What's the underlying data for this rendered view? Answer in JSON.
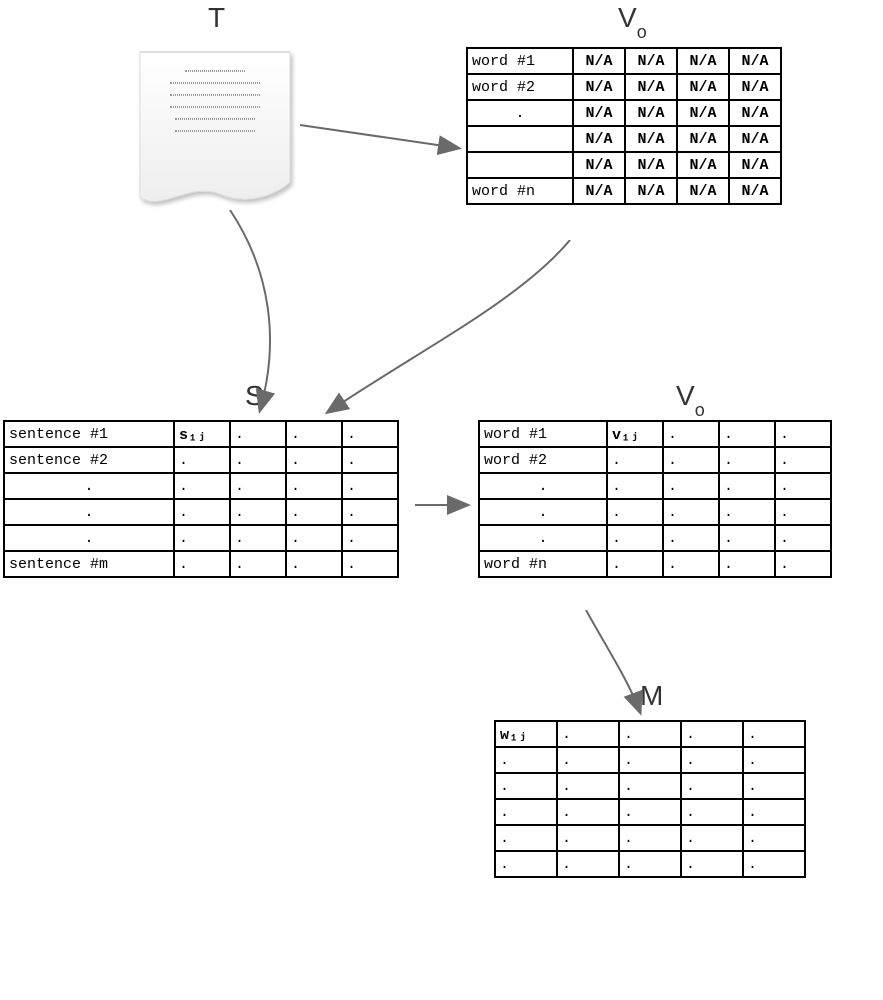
{
  "labels": {
    "T": "T",
    "Vo_top": "V",
    "Vo_top_sub": "o",
    "S": "S",
    "Vo_bot": "V",
    "Vo_bot_sub": "o",
    "M": "M"
  },
  "vo_top": {
    "rows": [
      {
        "label": "word #1",
        "cells": [
          "N/A",
          "N/A",
          "N/A",
          "N/A"
        ]
      },
      {
        "label": "word #2",
        "cells": [
          "N/A",
          "N/A",
          "N/A",
          "N/A"
        ]
      },
      {
        "label": ".",
        "cells": [
          "N/A",
          "N/A",
          "N/A",
          "N/A"
        ]
      },
      {
        "label": "",
        "cells": [
          "N/A",
          "N/A",
          "N/A",
          "N/A"
        ]
      },
      {
        "label": "",
        "cells": [
          "N/A",
          "N/A",
          "N/A",
          "N/A"
        ]
      },
      {
        "label": "word #n",
        "cells": [
          "N/A",
          "N/A",
          "N/A",
          "N/A"
        ]
      }
    ]
  },
  "s_table": {
    "rows": [
      {
        "label": "sentence #1",
        "cells": [
          "s₁ⱼ",
          ".",
          ".",
          "."
        ]
      },
      {
        "label": "sentence #2",
        "cells": [
          ".",
          ".",
          ".",
          "."
        ]
      },
      {
        "label": ".",
        "cells": [
          ".",
          ".",
          ".",
          "."
        ]
      },
      {
        "label": ".",
        "cells": [
          ".",
          ".",
          ".",
          "."
        ]
      },
      {
        "label": ".",
        "cells": [
          ".",
          ".",
          ".",
          "."
        ]
      },
      {
        "label": "sentence #m",
        "cells": [
          ".",
          ".",
          ".",
          "."
        ]
      }
    ]
  },
  "vo_bot": {
    "rows": [
      {
        "label": "word #1",
        "cells": [
          "v₁ⱼ",
          ".",
          ".",
          "."
        ]
      },
      {
        "label": "word #2",
        "cells": [
          ".",
          ".",
          ".",
          "."
        ]
      },
      {
        "label": ".",
        "cells": [
          ".",
          ".",
          ".",
          "."
        ]
      },
      {
        "label": ".",
        "cells": [
          ".",
          ".",
          ".",
          "."
        ]
      },
      {
        "label": ".",
        "cells": [
          ".",
          ".",
          ".",
          "."
        ]
      },
      {
        "label": "word #n",
        "cells": [
          ".",
          ".",
          ".",
          "."
        ]
      }
    ]
  },
  "m_table": {
    "rows": [
      [
        "w₁ⱼ",
        ".",
        ".",
        ".",
        "."
      ],
      [
        ".",
        ".",
        ".",
        ".",
        "."
      ],
      [
        ".",
        ".",
        ".",
        ".",
        "."
      ],
      [
        ".",
        ".",
        ".",
        ".",
        "."
      ],
      [
        ".",
        ".",
        ".",
        ".",
        "."
      ],
      [
        ".",
        ".",
        ".",
        ".",
        "."
      ]
    ]
  }
}
